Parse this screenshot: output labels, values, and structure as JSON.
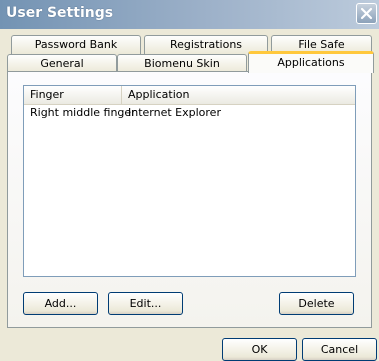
{
  "window": {
    "title": "User Settings"
  },
  "tabs": {
    "back_row": [
      {
        "label": "Password Bank"
      },
      {
        "label": "Registrations"
      },
      {
        "label": "File Safe"
      }
    ],
    "front_row": [
      {
        "label": "General"
      },
      {
        "label": "Biomenu Skin"
      },
      {
        "label": "Applications",
        "active": true
      }
    ]
  },
  "list": {
    "columns": [
      {
        "label": "Finger"
      },
      {
        "label": "Application"
      }
    ],
    "rows": [
      {
        "finger": "Right middle finger",
        "application": "Internet Explorer"
      }
    ]
  },
  "buttons": {
    "add": "Add...",
    "edit": "Edit...",
    "delete": "Delete",
    "ok": "OK",
    "cancel": "Cancel"
  },
  "colors": {
    "active_tab_accent": "#ffc83c",
    "dialog_background": "#ece9d8",
    "button_border": "#003c74"
  }
}
